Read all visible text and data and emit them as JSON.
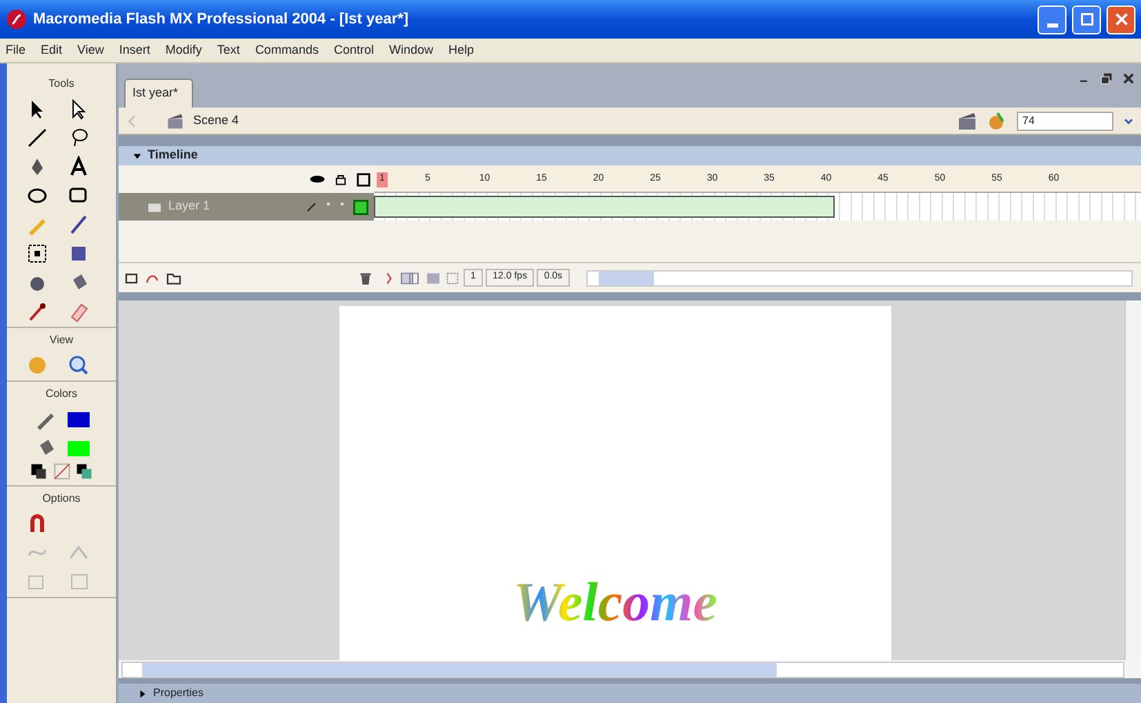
{
  "window": {
    "title": "Macromedia Flash MX Professional 2004 - [Ist year*]"
  },
  "menu": [
    "File",
    "Edit",
    "View",
    "Insert",
    "Modify",
    "Text",
    "Commands",
    "Control",
    "Window",
    "Help"
  ],
  "tools_panel": {
    "sections": [
      {
        "title": "Tools",
        "kind": "tools"
      },
      {
        "title": "View",
        "kind": "view"
      },
      {
        "title": "Colors",
        "kind": "colors",
        "swatches": [
          {
            "kind": "stroke",
            "color": "#0000cc"
          },
          {
            "kind": "fill",
            "color": "#00ff00"
          }
        ]
      },
      {
        "title": "Options",
        "kind": "options"
      }
    ]
  },
  "document_tab": {
    "label": "Ist year*",
    "selected": true
  },
  "scene_bar": {
    "scene": "Scene 4",
    "zoom": "74"
  },
  "timeline": {
    "title": "Timeline",
    "expanded": true,
    "ruler": [
      "1",
      "5",
      "10",
      "15",
      "20",
      "25",
      "30",
      "35",
      "40",
      "45",
      "50",
      "55",
      "60"
    ],
    "layers": [
      {
        "name": "Layer 1",
        "selected": true,
        "level": 0.6
      }
    ],
    "current_frame": "1",
    "frame_rate": "12.0 fps",
    "elapsed": "0.0s"
  },
  "stage": {
    "text": "Welcome"
  },
  "properties": {
    "title": "Properties",
    "expanded": false
  }
}
